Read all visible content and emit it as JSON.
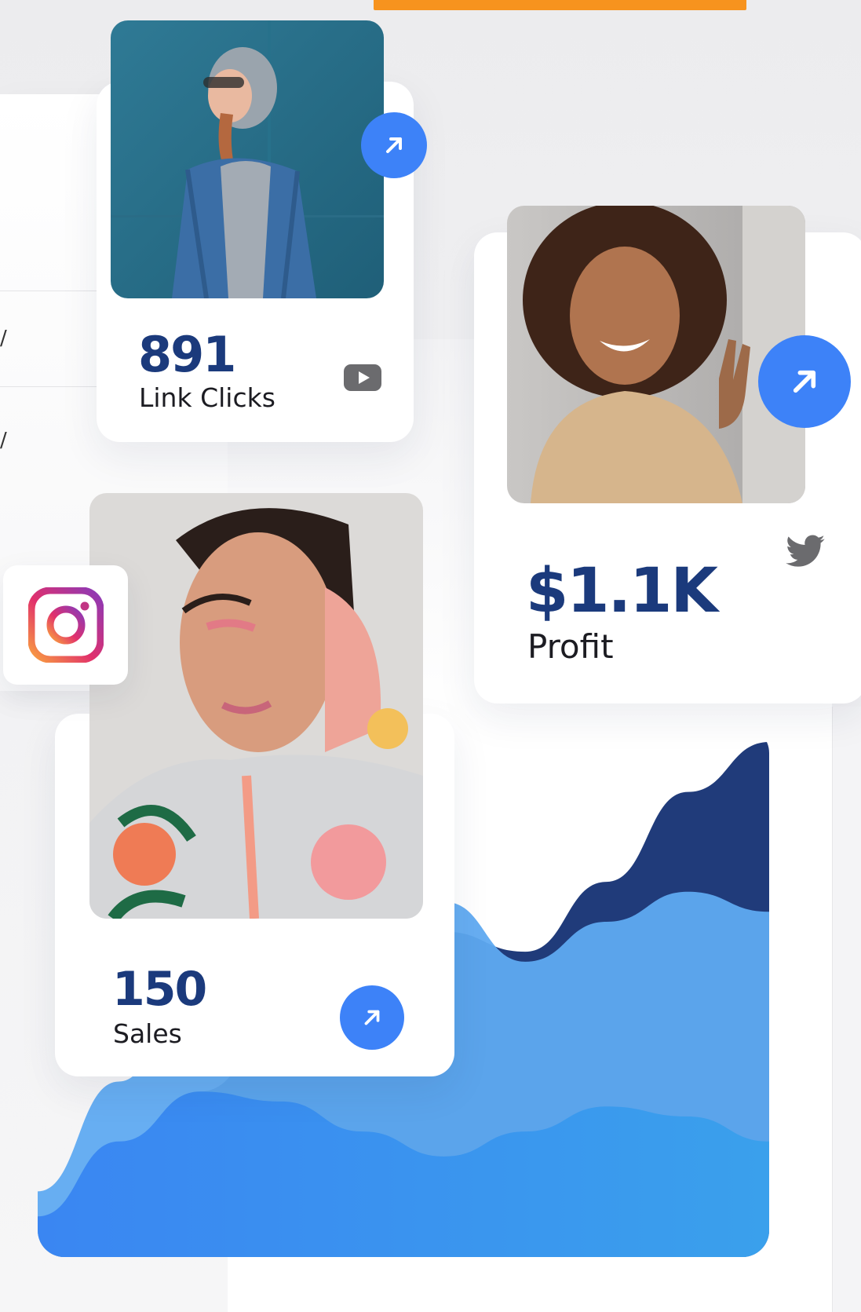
{
  "colors": {
    "accent_orange": "#f7931e",
    "stat_navy": "#1b3a7c",
    "button_blue": "#3d82f8",
    "chart_navy": "#203b7a",
    "chart_sky": "#5faaf1",
    "chart_blue": "#3f8fe6"
  },
  "background": {
    "left_panel_glyphs": [
      "/",
      "/"
    ]
  },
  "cards": {
    "clicks": {
      "value": "891",
      "label": "Link Clicks",
      "platform_icon": "youtube-icon",
      "action_icon": "arrow-up-right-icon"
    },
    "profit": {
      "value": "$1.1K",
      "label": "Profit",
      "platform_icon": "twitter-icon",
      "action_icon": "arrow-up-right-icon"
    },
    "sales": {
      "value": "150",
      "label": "Sales",
      "platform_icon": "instagram-icon",
      "action_icon": "arrow-up-right-icon"
    }
  },
  "chart_data": {
    "type": "area",
    "title": "",
    "xlabel": "",
    "ylabel": "",
    "grid": false,
    "legend": "none",
    "series": [
      {
        "values": [
          0.0,
          0.18,
          0.3,
          0.42,
          0.55,
          0.62,
          0.58,
          0.72,
          0.9,
          1.0
        ]
      },
      {
        "values": [
          0.1,
          0.32,
          0.55,
          0.62,
          0.7,
          0.68,
          0.56,
          0.64,
          0.7,
          0.66
        ]
      },
      {
        "values": [
          0.05,
          0.2,
          0.3,
          0.28,
          0.22,
          0.17,
          0.22,
          0.27,
          0.25,
          0.2
        ]
      }
    ]
  }
}
